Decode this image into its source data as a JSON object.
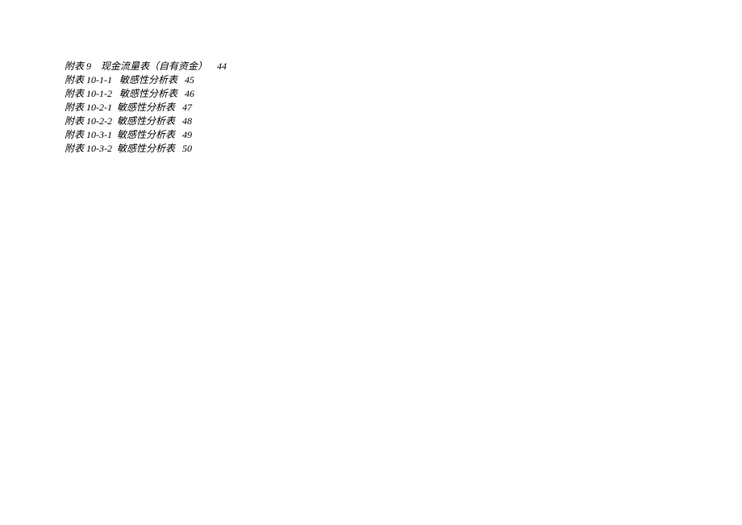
{
  "toc": {
    "lines": [
      "附表 9    现金流量表（自有资金）    44",
      "附表 10-1-1   敏感性分析表   45",
      "附表 10-1-2   敏感性分析表   46",
      "附表 10-2-1  敏感性分析表   47",
      "附表 10-2-2  敏感性分析表   48",
      "附表 10-3-1  敏感性分析表   49",
      "附表 10-3-2  敏感性分析表   50"
    ]
  }
}
